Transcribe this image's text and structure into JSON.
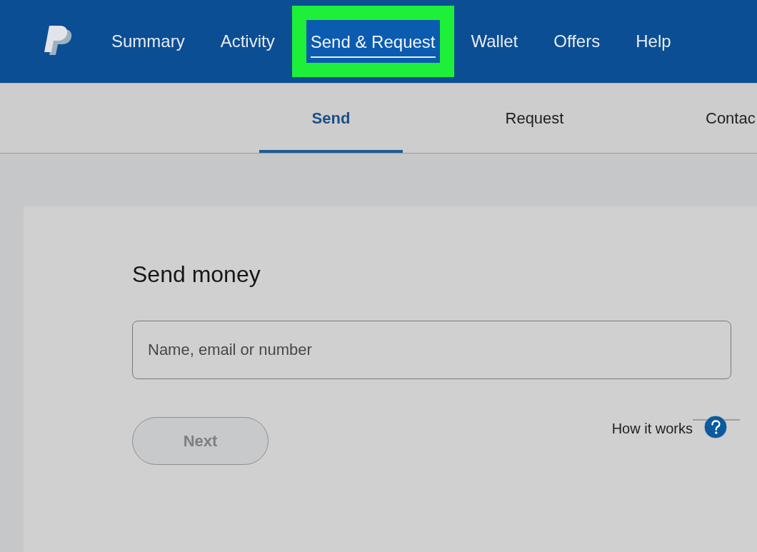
{
  "nav": {
    "items": [
      {
        "label": "Summary",
        "selected": false,
        "highlighted": false
      },
      {
        "label": "Activity",
        "selected": false,
        "highlighted": false
      },
      {
        "label": "Send & Request",
        "selected": true,
        "highlighted": true
      },
      {
        "label": "Wallet",
        "selected": false,
        "highlighted": false
      },
      {
        "label": "Offers",
        "selected": false,
        "highlighted": false
      },
      {
        "label": "Help",
        "selected": false,
        "highlighted": false
      }
    ]
  },
  "subnav": {
    "tabs": [
      {
        "label": "Send",
        "selected": true
      },
      {
        "label": "Request",
        "selected": false
      },
      {
        "label": "Contac",
        "selected": false
      }
    ]
  },
  "send_card": {
    "title": "Send money",
    "recipient_field": {
      "placeholder": "Name, email or number"
    },
    "next_button": {
      "label": "Next",
      "disabled": true
    },
    "help_link": {
      "label": "How it works"
    }
  }
}
